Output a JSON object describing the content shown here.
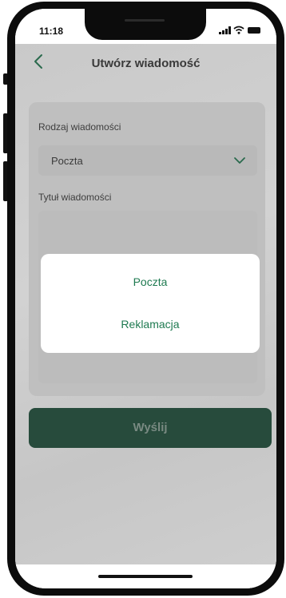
{
  "status_bar": {
    "time": "11:18"
  },
  "header": {
    "back_icon": "chevron-left-icon",
    "title": "Utwórz wiadomość"
  },
  "form": {
    "type_label": "Rodzaj wiadomości",
    "type_value": "Poczta",
    "title_label": "Tytuł wiadomości"
  },
  "send_button": {
    "label": "Wyślij"
  },
  "picker": {
    "options": [
      "Poczta",
      "Reklamacja"
    ]
  },
  "colors": {
    "accent_green": "#1e7a50",
    "button_green": "#274b3c"
  }
}
